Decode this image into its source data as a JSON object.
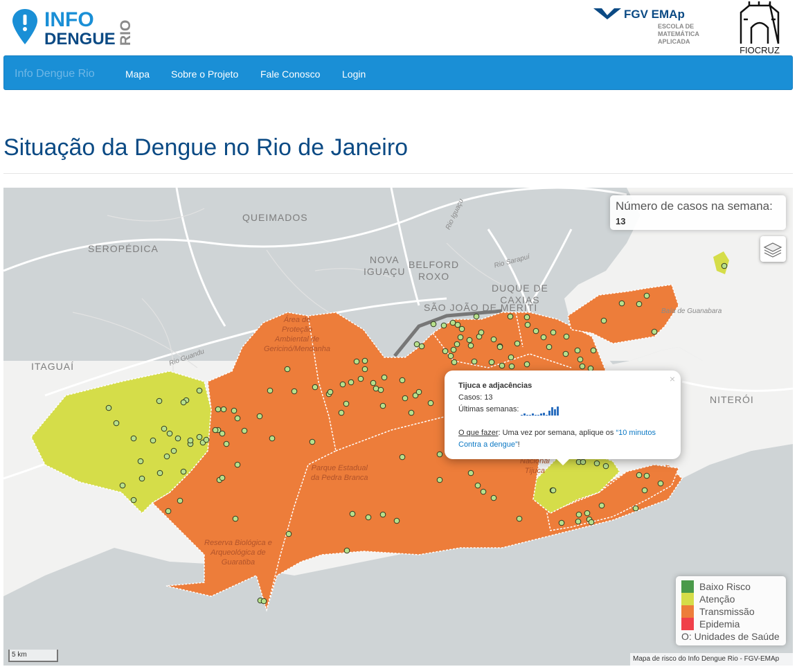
{
  "header": {
    "logo_line1": "INFO",
    "logo_line2": "DENGUE",
    "logo_side": "RIO",
    "partner1_name": "FGV EMAp",
    "partner1_line1": "ESCOLA DE",
    "partner1_line2": "MATEMÁTICA",
    "partner1_line3": "APLICADA",
    "partner2_name": "FIOCRUZ"
  },
  "navbar": {
    "brand": "Info Dengue Rio",
    "items": [
      "Mapa",
      "Sobre o Projeto",
      "Fale Conosco",
      "Login"
    ]
  },
  "page": {
    "title": "Situação da Dengue no Rio de Janeiro"
  },
  "map": {
    "labels": {
      "queimados": "QUEIMADOS",
      "seropedica": "SEROPÉDICA",
      "nova_iguacu_1": "NOVA",
      "nova_iguacu_2": "IGUAÇU",
      "belford_roxo_1": "BELFORD",
      "belford_roxo_2": "ROXO",
      "duque_1": "DUQUE DE",
      "duque_2": "CAXIAS",
      "sao_joao": "SÃO JOÃO DE MERITI",
      "itaguai": "ITAGUAÍ",
      "niteroi": "NITERÓI",
      "rio_iguacu": "Rio Iguaçu",
      "rio_sarapui": "Rio Sarapuí",
      "rio_guandu": "Rio Guandu",
      "baia": "Baía de Guanabara",
      "area_gericino_1": "Área de",
      "area_gericino_2": "Proteção",
      "area_gericino_3": "Ambiental de",
      "area_gericino_4": "Gericinó/Mendanha",
      "pedra_branca_1": "Parque Estadual",
      "pedra_branca_2": "da Pedra Branca",
      "guaratiba_1": "Reserva Biológica e",
      "guaratiba_2": "Arqueológica de",
      "guaratiba_3": "Guaratiba",
      "tijuca_1": "Nacional",
      "tijuca_2": "Tijuca"
    },
    "cases_box": {
      "title": "Número de casos na semana:",
      "value": "13"
    },
    "popup": {
      "region": "Tijuca e adjacências",
      "cases_label": "Casos:",
      "cases_value": "13",
      "weeks_label": "Últimas semanas:",
      "weekly_series": [
        1,
        2,
        1,
        1,
        2,
        1,
        1,
        2,
        3,
        1,
        5,
        8,
        6,
        9
      ],
      "action_label": "O que fazer",
      "action_text": ": Uma vez por semana, aplique os ",
      "action_link": "“10 minutos Contra a dengue”",
      "action_end": "!",
      "close": "×"
    },
    "legend": {
      "items": [
        {
          "label": "Baixo Risco",
          "color": "#4a9a4a"
        },
        {
          "label": "Atenção",
          "color": "#d5dd49"
        },
        {
          "label": "Transmissão",
          "color": "#ed7d3a"
        },
        {
          "label": "Epidemia",
          "color": "#f0404a"
        }
      ],
      "units_label": "O: Unidades de Saúde"
    },
    "scale": "5 km",
    "attribution": "Mapa de risco do Info Dengue Rio - FGV-EMAp",
    "colors": {
      "water": "#cfd4d6",
      "land": "#f2f2f1",
      "transmissao": "#ed7d3a",
      "atencao": "#d5dd49",
      "unit_fill": "#b7e08c"
    }
  }
}
